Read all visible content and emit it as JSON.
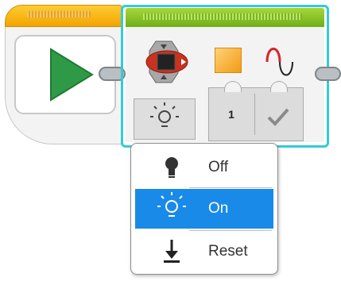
{
  "light_block": {
    "number_value": "1"
  },
  "mode_menu": {
    "items": [
      {
        "label": "Off",
        "icon": "bulb-icon",
        "selected": false
      },
      {
        "label": "On",
        "icon": "light-on-icon",
        "selected": true
      },
      {
        "label": "Reset",
        "icon": "reset-icon",
        "selected": false
      }
    ]
  },
  "colors": {
    "start_header": "#f2a400",
    "light_header": "#8cc63f",
    "selection_outline": "#33ccd4",
    "play_green": "#2e9a48",
    "menu_highlight": "#1a8ae8",
    "color_swatch": "#f6a21e",
    "wave_red": "#d8232a"
  }
}
